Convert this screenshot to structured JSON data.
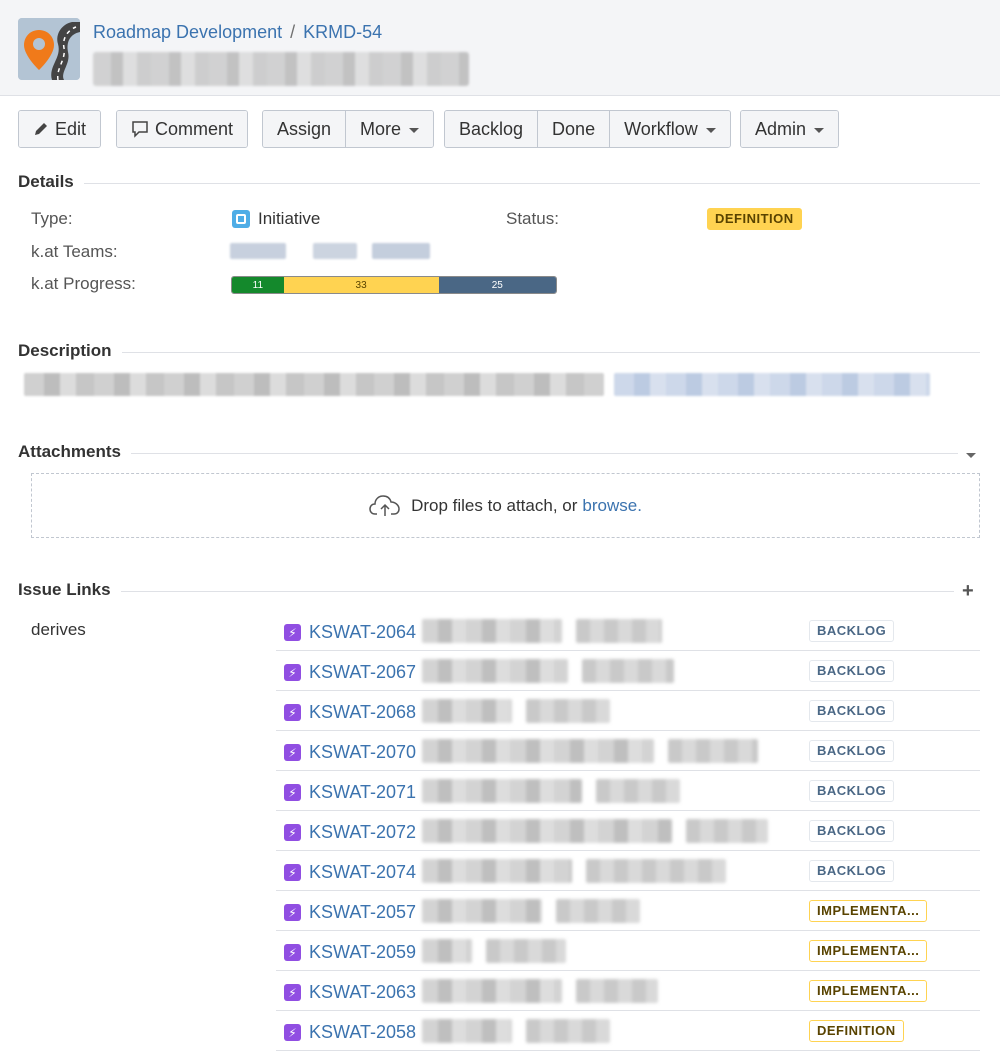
{
  "breadcrumb": {
    "project": "Roadmap Development",
    "separator": "/",
    "issue_key": "KRMD-54"
  },
  "toolbar": {
    "edit": "Edit",
    "comment": "Comment",
    "assign": "Assign",
    "more": "More",
    "backlog": "Backlog",
    "done": "Done",
    "workflow": "Workflow",
    "admin": "Admin"
  },
  "details": {
    "title": "Details",
    "type_label": "Type:",
    "type_value": "Initiative",
    "status_label": "Status:",
    "status_value": "DEFINITION",
    "teams_label": "k.at Teams:",
    "progress_label": "k.at Progress:",
    "progress": {
      "done": 11,
      "in_progress": 33,
      "todo": 25
    }
  },
  "description": {
    "title": "Description"
  },
  "attachments": {
    "title": "Attachments",
    "drop_text": "Drop files to attach, or",
    "browse": "browse."
  },
  "issue_links": {
    "title": "Issue Links",
    "link_type": "derives",
    "rows": [
      {
        "key": "KSWAT-2064",
        "status": "BACKLOG"
      },
      {
        "key": "KSWAT-2067",
        "status": "BACKLOG"
      },
      {
        "key": "KSWAT-2068",
        "status": "BACKLOG"
      },
      {
        "key": "KSWAT-2070",
        "status": "BACKLOG"
      },
      {
        "key": "KSWAT-2071",
        "status": "BACKLOG"
      },
      {
        "key": "KSWAT-2072",
        "status": "BACKLOG"
      },
      {
        "key": "KSWAT-2074",
        "status": "BACKLOG"
      },
      {
        "key": "KSWAT-2057",
        "status": "IMPLEMENTA..."
      },
      {
        "key": "KSWAT-2059",
        "status": "IMPLEMENTA..."
      },
      {
        "key": "KSWAT-2063",
        "status": "IMPLEMENTA..."
      },
      {
        "key": "KSWAT-2058",
        "status": "DEFINITION"
      }
    ]
  },
  "colors": {
    "link": "#3b73af",
    "progress_done": "#14892c",
    "progress_in_progress": "#ffd351",
    "progress_todo": "#4a6785",
    "epic": "#904ee2"
  }
}
